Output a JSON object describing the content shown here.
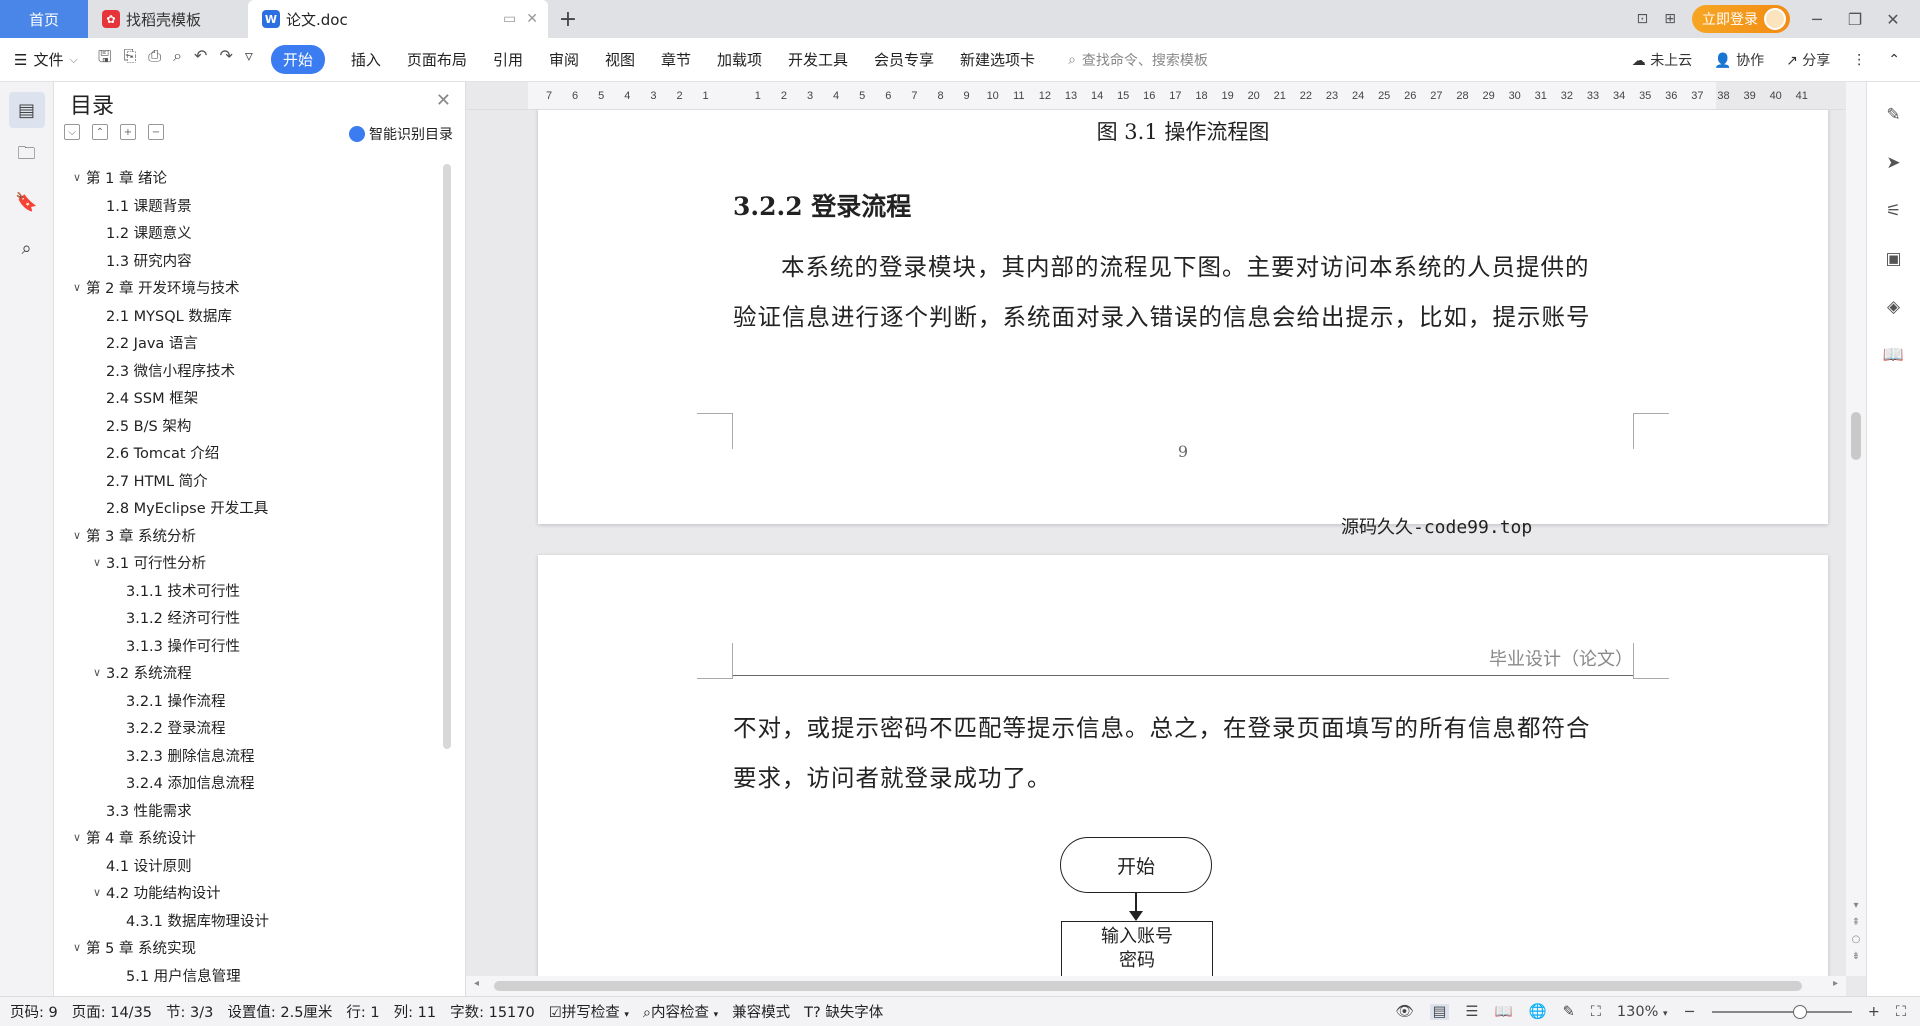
{
  "tabs": {
    "home": "首页",
    "template": "找稻壳模板",
    "doc": "论文.doc",
    "login": "立即登录"
  },
  "ribbon": {
    "file": "文件",
    "tabs": [
      "开始",
      "插入",
      "页面布局",
      "引用",
      "审阅",
      "视图",
      "章节",
      "加载项",
      "开发工具",
      "会员专享",
      "新建选项卡"
    ],
    "search_placeholder": "查找命令、搜索模板",
    "cloud": "未上云",
    "collab": "协作",
    "share": "分享"
  },
  "toc": {
    "title": "目录",
    "smart": "智能识别目录",
    "items": [
      {
        "label": "第 1 章  绪论",
        "level": "l1",
        "chev": "v"
      },
      {
        "label": "1.1  课题背景",
        "level": "l2",
        "chev": ""
      },
      {
        "label": "1.2  课题意义",
        "level": "l2",
        "chev": ""
      },
      {
        "label": "1.3  研究内容",
        "level": "l2",
        "chev": ""
      },
      {
        "label": "第 2 章  开发环境与技术",
        "level": "l1",
        "chev": "v"
      },
      {
        "label": "2.1 MYSQL 数据库",
        "level": "l2",
        "chev": ""
      },
      {
        "label": "2.2 Java 语言",
        "level": "l2",
        "chev": ""
      },
      {
        "label": "2.3  微信小程序技术",
        "level": "l2",
        "chev": ""
      },
      {
        "label": "2.4 SSM 框架",
        "level": "l2",
        "chev": ""
      },
      {
        "label": "2.5 B/S 架构",
        "level": "l2",
        "chev": ""
      },
      {
        "label": "2.6 Tomcat  介绍",
        "level": "l2",
        "chev": ""
      },
      {
        "label": "2.7 HTML 简介",
        "level": "l2",
        "chev": ""
      },
      {
        "label": "2.8 MyEclipse 开发工具",
        "level": "l2",
        "chev": ""
      },
      {
        "label": "第 3 章  系统分析",
        "level": "l1",
        "chev": "v"
      },
      {
        "label": "3.1  可行性分析",
        "level": "l2c",
        "chev": "v"
      },
      {
        "label": "3.1.1  技术可行性",
        "level": "l3",
        "chev": ""
      },
      {
        "label": "3.1.2  经济可行性",
        "level": "l3",
        "chev": ""
      },
      {
        "label": "3.1.3  操作可行性",
        "level": "l3",
        "chev": ""
      },
      {
        "label": "3.2  系统流程",
        "level": "l2c",
        "chev": "v"
      },
      {
        "label": "3.2.1  操作流程",
        "level": "l3",
        "chev": ""
      },
      {
        "label": "3.2.2  登录流程",
        "level": "l3",
        "chev": ""
      },
      {
        "label": "3.2.3  删除信息流程",
        "level": "l3",
        "chev": ""
      },
      {
        "label": "3.2.4  添加信息流程",
        "level": "l3",
        "chev": ""
      },
      {
        "label": "3.3  性能需求",
        "level": "l2",
        "chev": ""
      },
      {
        "label": "第 4 章  系统设计",
        "level": "l1",
        "chev": "v"
      },
      {
        "label": "4.1  设计原则",
        "level": "l2",
        "chev": ""
      },
      {
        "label": "4.2  功能结构设计",
        "level": "l2c",
        "chev": "v"
      },
      {
        "label": "4.3.1  数据库物理设计",
        "level": "l3",
        "chev": ""
      },
      {
        "label": "第 5 章  系统实现",
        "level": "l1",
        "chev": "v"
      },
      {
        "label": "5.1 用户信息管理",
        "level": "l3",
        "chev": ""
      }
    ]
  },
  "ruler": {
    "labels": [
      "7",
      "6",
      "5",
      "4",
      "3",
      "2",
      "1",
      "",
      "1",
      "2",
      "3",
      "4",
      "5",
      "6",
      "7",
      "8",
      "9",
      "10",
      "11",
      "12",
      "13",
      "14",
      "15",
      "16",
      "17",
      "18",
      "19",
      "20",
      "21",
      "22",
      "23",
      "24",
      "25",
      "26",
      "27",
      "28",
      "29",
      "30",
      "31",
      "32",
      "33",
      "34",
      "35",
      "36",
      "37",
      "38",
      "39",
      "40",
      "41"
    ]
  },
  "page1": {
    "figure_caption": "图 3.1  操作流程图",
    "section_heading": "3.2.2  登录流程",
    "paragraph_line1": "本系统的登录模块，其内部的流程见下图。主要对访问本系统的人员提供的",
    "paragraph_line2": "验证信息进行逐个判断，系统面对录入错误的信息会给出提示，比如，提示账号",
    "page_number": "9"
  },
  "watermark": "源码久久-code99.top",
  "page2": {
    "header": "毕业设计（论文）",
    "paragraph_line1": "不对，或提示密码不匹配等提示信息。总之，在登录页面填写的所有信息都符合",
    "paragraph_line2": "要求，访问者就登录成功了。",
    "flow_start": "开始",
    "flow_input_line1": "输入账号",
    "flow_input_line2": "密码"
  },
  "status": {
    "page_code": "页码: 9",
    "page": "页面: 14/35",
    "section": "节: 3/3",
    "setting": "设置值: 2.5厘米",
    "row": "行: 1",
    "col": "列: 11",
    "words": "字数: 15170",
    "spell": "拼写检查",
    "content_check": "内容检查",
    "compat": "兼容模式",
    "missing_font": "缺失字体",
    "zoom": "130%",
    "zoom_level": 0.63
  },
  "colors": {
    "accent": "#3b7cf0",
    "home_tab": "#4a86e8",
    "login": "#f38b14"
  }
}
